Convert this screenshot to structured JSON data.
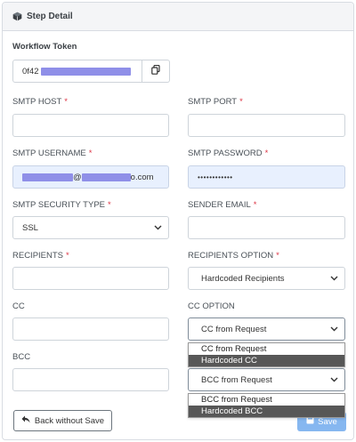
{
  "header": {
    "title": "Step Detail",
    "icon": "cube-icon"
  },
  "token": {
    "label": "Workflow Token",
    "value_prefix": "0f42"
  },
  "smtp_host": {
    "label": "SMTP HOST",
    "required": "*",
    "value": ""
  },
  "smtp_port": {
    "label": "SMTP PORT",
    "required": "*",
    "value": ""
  },
  "smtp_username": {
    "label": "SMTP USERNAME",
    "required": "*",
    "value_at": "@",
    "value_suffix": "o.com"
  },
  "smtp_password": {
    "label": "SMTP PASSWORD",
    "required": "*",
    "value": "••••••••••••"
  },
  "smtp_security": {
    "label": "SMTP SECURITY TYPE",
    "required": "*",
    "value": "SSL"
  },
  "sender_email": {
    "label": "SENDER EMAIL",
    "required": "*",
    "value": ""
  },
  "recipients": {
    "label": "RECIPIENTS",
    "required": "*",
    "value": ""
  },
  "recipients_option": {
    "label": "RECIPIENTS OPTION",
    "required": "*",
    "value": "Hardcoded Recipients"
  },
  "cc": {
    "label": "CC",
    "value": ""
  },
  "cc_option": {
    "label": "CC OPTION",
    "value": "CC from Request",
    "options": [
      "CC from Request",
      "Hardcoded CC"
    ],
    "highlighted": "Hardcoded CC"
  },
  "bcc": {
    "label": "BCC",
    "value": ""
  },
  "bcc_option": {
    "value": "BCC from Request",
    "options": [
      "BCC from Request",
      "Hardcoded BCC"
    ],
    "highlighted": "Hardcoded BCC"
  },
  "footer": {
    "back_label": "Back without Save",
    "save_label": "Save"
  }
}
